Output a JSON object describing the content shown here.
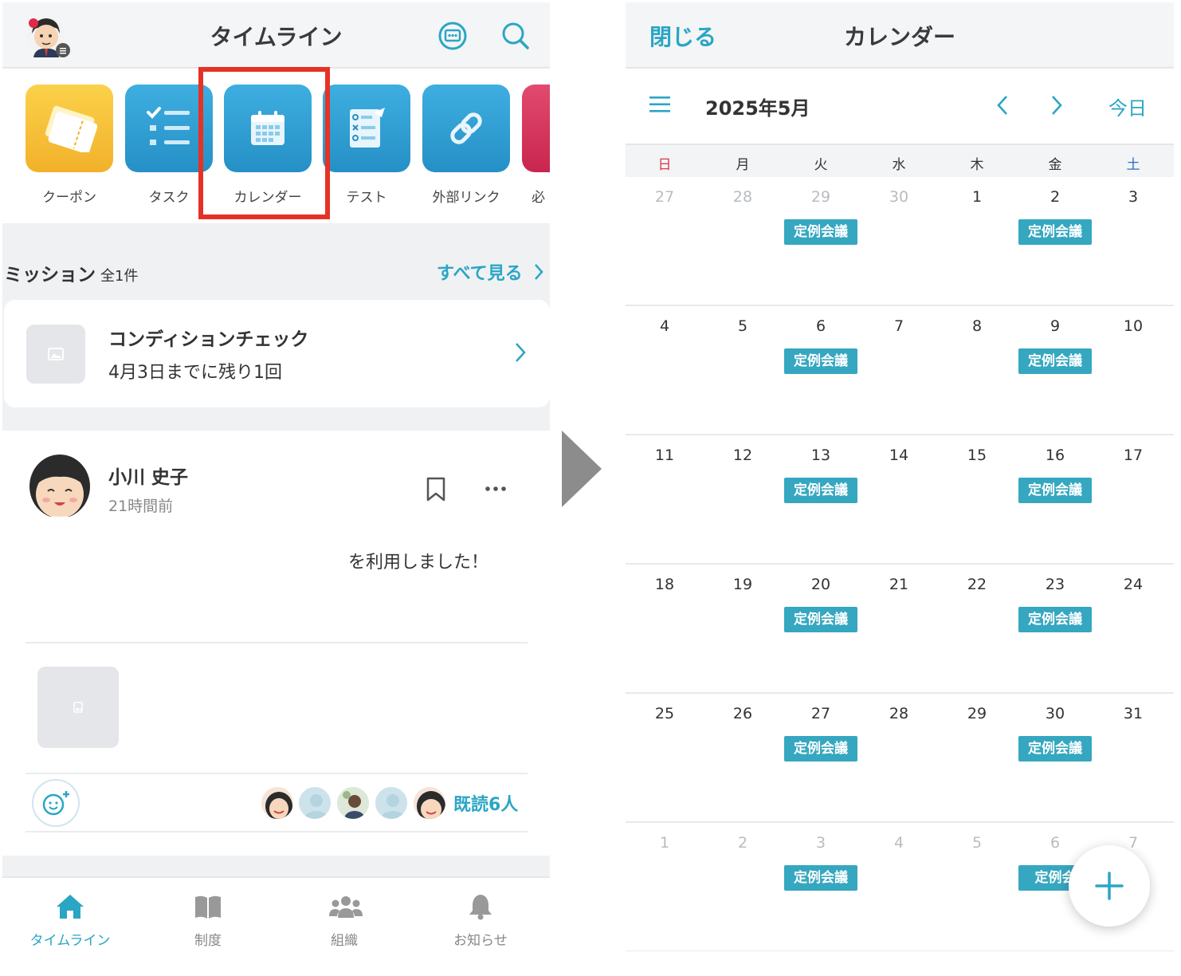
{
  "left": {
    "header": {
      "title": "タイムライン"
    },
    "apps": [
      {
        "label": "クーポン",
        "icon": "ticket-icon",
        "color": "#f7c43a"
      },
      {
        "label": "タスク",
        "icon": "checklist-icon",
        "color": "#2f9fd0"
      },
      {
        "label": "カレンダー",
        "icon": "calendar-icon",
        "color": "#2f9fd0"
      },
      {
        "label": "テスト",
        "icon": "test-icon",
        "color": "#2f9fd0"
      },
      {
        "label": "外部リンク",
        "icon": "link-icon",
        "color": "#2f9fd0"
      },
      {
        "label": "必",
        "icon": "partial-app-icon",
        "color": "#d8325a"
      }
    ],
    "mission": {
      "title": "ミッション",
      "count": "全1件",
      "see_all": "すべて見る",
      "card_title": "コンディションチェック",
      "card_sub": "4月3日までに残り1回"
    },
    "post": {
      "author": "小川 史子",
      "time": "21時間前",
      "text": "を利用しました！",
      "read_label": "既読6人"
    },
    "tabs": [
      {
        "label": "タイムライン",
        "icon": "home-icon",
        "active": true
      },
      {
        "label": "制度",
        "icon": "book-icon",
        "active": false
      },
      {
        "label": "組織",
        "icon": "people-icon",
        "active": false
      },
      {
        "label": "お知らせ",
        "icon": "bell-icon",
        "active": false
      }
    ]
  },
  "right": {
    "header": {
      "close": "閉じる",
      "title": "カレンダー"
    },
    "month": "2025年5月",
    "today": "今日",
    "weekdays": [
      "日",
      "月",
      "火",
      "水",
      "木",
      "金",
      "土"
    ],
    "event_label": "定例会議",
    "event_label_partial": "定例会",
    "weeks": [
      [
        {
          "d": "27",
          "o": true,
          "e": false
        },
        {
          "d": "28",
          "o": true,
          "e": false
        },
        {
          "d": "29",
          "o": true,
          "e": true
        },
        {
          "d": "30",
          "o": true,
          "e": false
        },
        {
          "d": "1",
          "o": false,
          "e": false
        },
        {
          "d": "2",
          "o": false,
          "e": true
        },
        {
          "d": "3",
          "o": false,
          "e": false
        }
      ],
      [
        {
          "d": "4",
          "o": false,
          "e": false
        },
        {
          "d": "5",
          "o": false,
          "e": false
        },
        {
          "d": "6",
          "o": false,
          "e": true
        },
        {
          "d": "7",
          "o": false,
          "e": false
        },
        {
          "d": "8",
          "o": false,
          "e": false
        },
        {
          "d": "9",
          "o": false,
          "e": true
        },
        {
          "d": "10",
          "o": false,
          "e": false
        }
      ],
      [
        {
          "d": "11",
          "o": false,
          "e": false
        },
        {
          "d": "12",
          "o": false,
          "e": false
        },
        {
          "d": "13",
          "o": false,
          "e": true
        },
        {
          "d": "14",
          "o": false,
          "e": false
        },
        {
          "d": "15",
          "o": false,
          "e": false
        },
        {
          "d": "16",
          "o": false,
          "e": true
        },
        {
          "d": "17",
          "o": false,
          "e": false
        }
      ],
      [
        {
          "d": "18",
          "o": false,
          "e": false
        },
        {
          "d": "19",
          "o": false,
          "e": false
        },
        {
          "d": "20",
          "o": false,
          "e": true
        },
        {
          "d": "21",
          "o": false,
          "e": false
        },
        {
          "d": "22",
          "o": false,
          "e": false
        },
        {
          "d": "23",
          "o": false,
          "e": true
        },
        {
          "d": "24",
          "o": false,
          "e": false
        }
      ],
      [
        {
          "d": "25",
          "o": false,
          "e": false
        },
        {
          "d": "26",
          "o": false,
          "e": false
        },
        {
          "d": "27",
          "o": false,
          "e": true
        },
        {
          "d": "28",
          "o": false,
          "e": false
        },
        {
          "d": "29",
          "o": false,
          "e": false
        },
        {
          "d": "30",
          "o": false,
          "e": true
        },
        {
          "d": "31",
          "o": false,
          "e": false
        }
      ],
      [
        {
          "d": "1",
          "o": true,
          "e": false
        },
        {
          "d": "2",
          "o": true,
          "e": false
        },
        {
          "d": "3",
          "o": true,
          "e": true
        },
        {
          "d": "4",
          "o": true,
          "e": false
        },
        {
          "d": "5",
          "o": true,
          "e": false
        },
        {
          "d": "6",
          "o": true,
          "e": true
        },
        {
          "d": "7",
          "o": true,
          "e": false
        }
      ]
    ]
  },
  "colors": {
    "accent": "#2aa6c4",
    "event": "#36a7c0",
    "highlight": "#e53224",
    "sunday": "#d83a4a",
    "saturday": "#2a6ec4"
  }
}
